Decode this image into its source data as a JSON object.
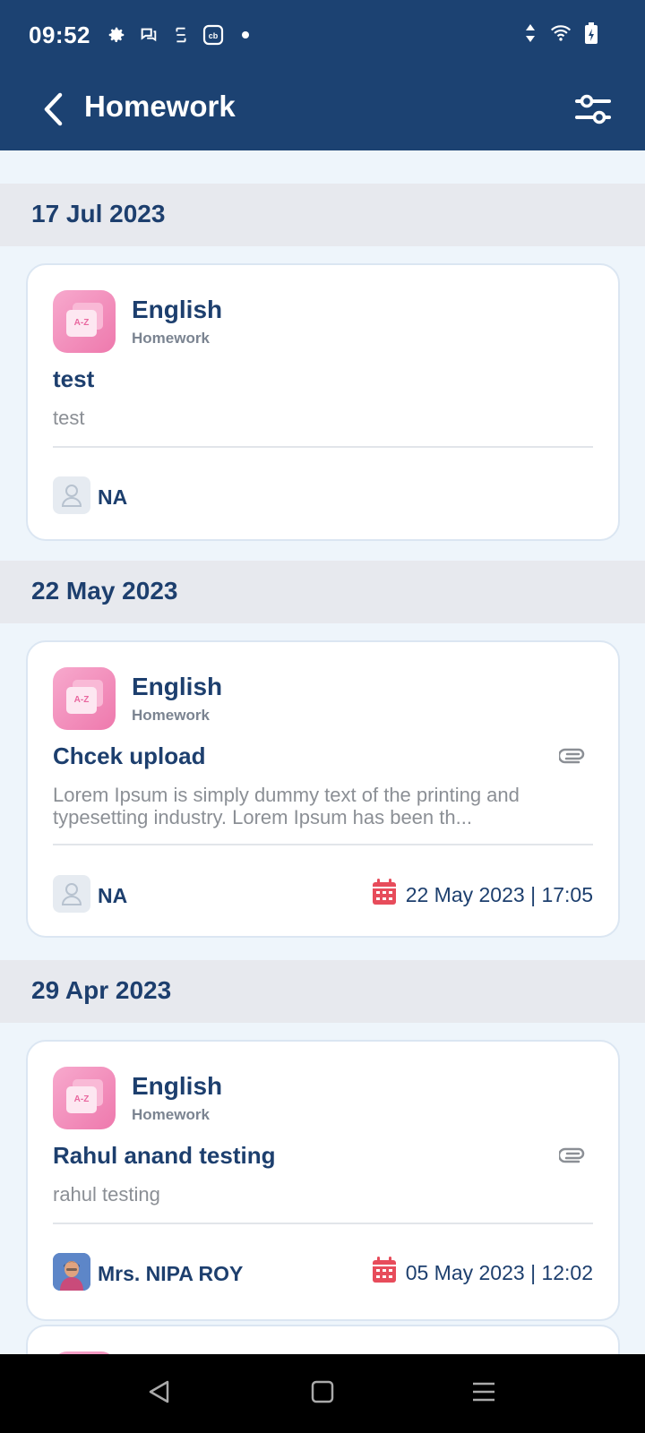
{
  "status_bar": {
    "time": "09:52",
    "left_icons": [
      "settings-icon",
      "chat-icon",
      "sim-icon",
      "cb-app-icon",
      "dot-icon"
    ],
    "right_icons": [
      "data-arrows-icon",
      "wifi-icon",
      "battery-charging-icon"
    ]
  },
  "app_bar": {
    "title": "Homework",
    "back_icon": "back-arrow-icon",
    "filter_icon": "filter-sliders-icon"
  },
  "colors": {
    "primary": "#1c4272",
    "background": "#eef5fb",
    "date_header_bg": "#e7e9ee",
    "subject_pink": "#ee79ad",
    "calendar_red": "#e74c5b"
  },
  "groups": [
    {
      "date": "17 Jul 2023",
      "cards": [
        {
          "subject_icon_text": "A-Z",
          "subject": "English",
          "type": "Homework",
          "title": "test",
          "description": "test",
          "has_attachment": false,
          "teacher": "NA",
          "teacher_avatar": "person-placeholder-icon",
          "due": ""
        }
      ]
    },
    {
      "date": "22 May 2023",
      "cards": [
        {
          "subject_icon_text": "A-Z",
          "subject": "English",
          "type": "Homework",
          "title": "Chcek upload",
          "description": "Lorem Ipsum is simply dummy text of the printing and typesetting industry. Lorem Ipsum has been th...",
          "has_attachment": true,
          "teacher": "NA",
          "teacher_avatar": "person-placeholder-icon",
          "due": "22 May 2023 | 17:05"
        }
      ]
    },
    {
      "date": "29 Apr 2023",
      "cards": [
        {
          "subject_icon_text": "A-Z",
          "subject": "English",
          "type": "Homework",
          "title": "Rahul anand testing",
          "description": "rahul testing",
          "has_attachment": true,
          "teacher": "Mrs. NIPA ROY",
          "teacher_avatar": "teacher-photo",
          "due": "05 May 2023 | 12:02"
        }
      ]
    }
  ],
  "nav_bar": {
    "buttons": [
      "nav-back-icon",
      "nav-home-icon",
      "nav-recents-icon"
    ]
  }
}
